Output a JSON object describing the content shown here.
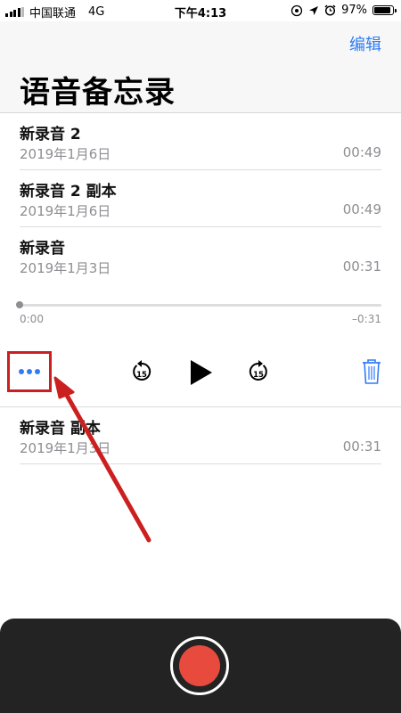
{
  "status_bar": {
    "carrier": "中国联通",
    "network": "4G",
    "time": "下午4:13",
    "battery": "97%",
    "battery_level": 0.97
  },
  "header": {
    "edit_label": "编辑",
    "title": "语音备忘录"
  },
  "recordings": [
    {
      "name": "新录音 2",
      "date": "2019年1月6日",
      "duration": "00:49"
    },
    {
      "name": "新录音 2 副本",
      "date": "2019年1月6日",
      "duration": "00:49"
    },
    {
      "name": "新录音",
      "date": "2019年1月3日",
      "duration": "00:31"
    },
    {
      "name": "新录音 副本",
      "date": "2019年1月3日",
      "duration": "00:31"
    }
  ],
  "player": {
    "elapsed": "0:00",
    "remaining": "–0:31",
    "progress": 0.0,
    "skip_back_seconds": "15",
    "skip_forward_seconds": "15"
  },
  "icons": [
    "signal-icon",
    "location-icon",
    "alarm-icon",
    "battery-icon",
    "more-icon",
    "skip-back-icon",
    "play-icon",
    "skip-forward-icon",
    "trash-icon",
    "record-icon"
  ],
  "colors": {
    "accent": "#2f7cf6",
    "highlight": "#cc1f1f",
    "record": "#e84a3e",
    "bottom_bar": "#232323"
  }
}
